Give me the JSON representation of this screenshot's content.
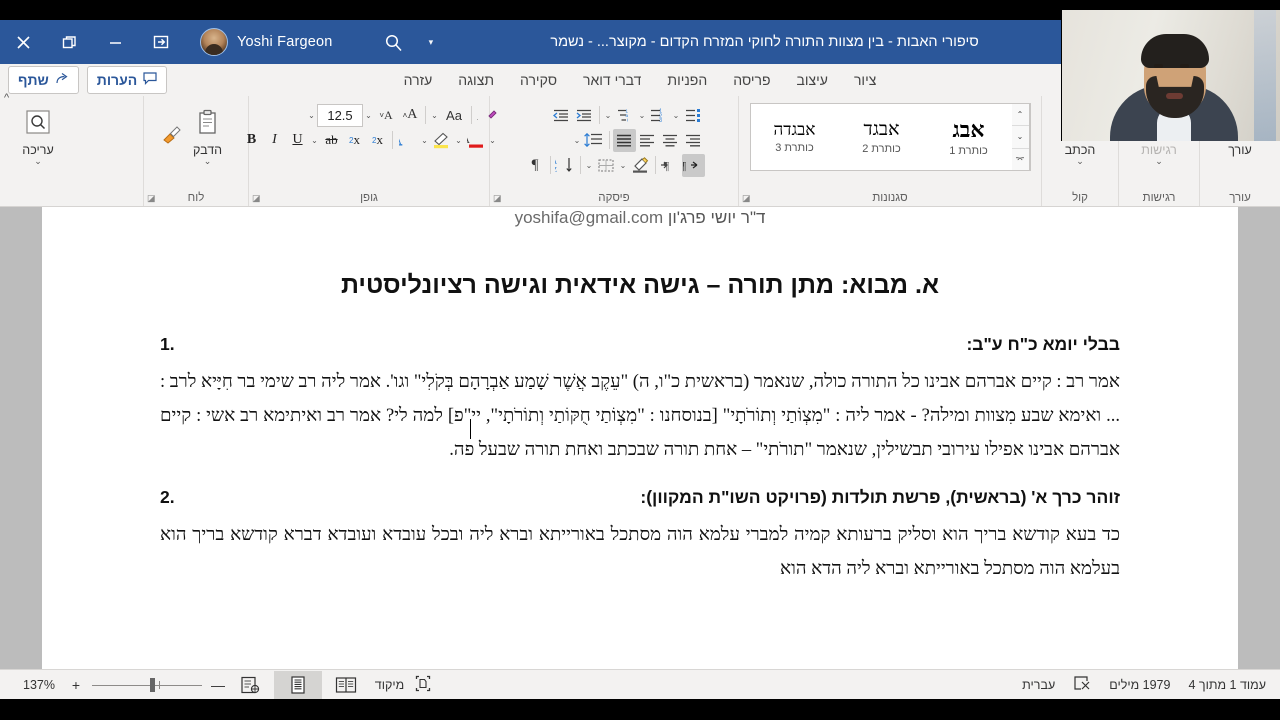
{
  "titlebar": {
    "close_label": "✕",
    "restore_label": "restore",
    "minimize_label": "—",
    "popout_label": "popout",
    "user_name": "Yoshi Fargeon",
    "search_icon": "search-icon",
    "caret": "▾",
    "document_title": "סיפורי האבות - בין מצוות התורה לחוקי המזרח הקדום - מקוצר... - נשמר",
    "autosave_caret": "▾",
    "undo_icon": "undo-icon",
    "redo_icon": "redo-icon",
    "more_caret": "▾"
  },
  "quick_pills": [
    {
      "label": "שתף",
      "icon": "share-icon"
    },
    {
      "label": "הערות",
      "icon": "comment-icon"
    }
  ],
  "tabs": [
    "ציור",
    "עיצוב",
    "פריסה",
    "הפניות",
    "דברי דואר",
    "סקירה",
    "תצוגה",
    "עזרה"
  ],
  "ribbon": {
    "groups": [
      {
        "name": "clipboard",
        "label": "לוח",
        "dialog": "◪",
        "buttons": [
          {
            "label": "הדבק",
            "icon": "paste-icon",
            "caret": "⌄"
          },
          {
            "label": "",
            "icon": "format-painter-icon",
            "caret": ""
          }
        ]
      },
      {
        "name": "font",
        "label": "גופן",
        "dialog": "◪",
        "font_size": "12.5",
        "row1": [
          {
            "icon": "clear-formatting-icon",
            "name": "clear-formatting"
          },
          {
            "icon": "change-case-icon",
            "name": "change-case",
            "label": "Aa"
          },
          {
            "icon": "decrease-font-icon",
            "name": "decrease-font",
            "label": "A˅"
          },
          {
            "icon": "increase-font-icon",
            "name": "increase-font",
            "label": "A˄"
          }
        ],
        "row2": [
          {
            "icon": "font-color-icon",
            "name": "font-color",
            "label": "A"
          },
          {
            "icon": "highlight-icon",
            "name": "text-highlight"
          },
          {
            "icon": "text-effects-icon",
            "name": "text-effects",
            "label": "A"
          },
          {
            "icon": "superscript-icon",
            "name": "superscript",
            "label": "x²"
          },
          {
            "icon": "subscript-icon",
            "name": "subscript",
            "label": "x₂"
          },
          {
            "icon": "strikethrough-icon",
            "name": "strikethrough",
            "label": "ab"
          },
          {
            "icon": "underline-icon",
            "name": "underline",
            "label": "U"
          },
          {
            "icon": "italic-icon",
            "name": "italic",
            "label": "I"
          },
          {
            "icon": "bold-icon",
            "name": "bold",
            "label": "B"
          }
        ]
      },
      {
        "name": "paragraph",
        "label": "פיסקה",
        "dialog": "◪",
        "row1": [
          {
            "name": "bullets",
            "icon": "bullet-list-icon"
          },
          {
            "name": "numbering",
            "icon": "numbered-list-icon"
          },
          {
            "name": "multilevel",
            "icon": "multilevel-list-icon"
          },
          {
            "name": "decrease-indent",
            "icon": "decrease-indent-icon"
          },
          {
            "name": "increase-indent",
            "icon": "increase-indent-icon"
          }
        ],
        "row2": [
          {
            "name": "align-right",
            "icon": "align-right-icon"
          },
          {
            "name": "align-center",
            "icon": "align-center-icon"
          },
          {
            "name": "align-left",
            "icon": "align-left-icon"
          },
          {
            "name": "justify",
            "icon": "justify-icon",
            "active": true
          },
          {
            "name": "line-spacing",
            "icon": "line-spacing-icon"
          }
        ],
        "row3": [
          {
            "name": "rtl-text-direction",
            "icon": "rtl-direction-icon",
            "label": "¶<",
            "active": true
          },
          {
            "name": "ltr-text-direction",
            "icon": "ltr-direction-icon",
            "label": ">¶"
          },
          {
            "name": "shading",
            "icon": "shading-icon"
          },
          {
            "name": "borders",
            "icon": "borders-icon"
          },
          {
            "name": "sort",
            "icon": "sort-az-icon"
          },
          {
            "name": "show-marks",
            "icon": "pilcrow-icon",
            "label": "¶"
          }
        ]
      },
      {
        "name": "styles",
        "label": "סגנונות",
        "dialog": "◪",
        "items": [
          {
            "sample": "אבג",
            "caption": "כותרת 1",
            "size": "22"
          },
          {
            "sample": "אבגד",
            "caption": "כותרת 2",
            "size": "19"
          },
          {
            "sample": "אבגדה",
            "caption": "כותרת 3",
            "size": "17"
          }
        ]
      },
      {
        "name": "voice",
        "label": "קול",
        "buttons": [
          {
            "label": "הכתב",
            "icon": "microphone-icon",
            "caret": "⌄"
          }
        ]
      },
      {
        "name": "sensitivity",
        "label": "רגישות",
        "buttons": [
          {
            "label": "רגישות",
            "icon": "sensitivity-label-icon",
            "caret": "⌄",
            "disabled": true
          }
        ]
      },
      {
        "name": "editor",
        "label": "עורך",
        "buttons": [
          {
            "label": "עורך",
            "icon": "editor-pen-icon",
            "caret": ""
          }
        ]
      }
    ],
    "find_group": {
      "label": "עריכה",
      "icon": "find-icon",
      "caret": "⌄"
    },
    "collapse_icon": "^"
  },
  "document": {
    "header_line": {
      "name_he": "ד\"ר יושי פרג'ון",
      "email": "yoshifa@gmail.com"
    },
    "title": "א. מבוא: מתן תורה – גישה אידאית וגישה רציונליסטית",
    "items": [
      {
        "number": "1.",
        "heading": "בבלי יומא כ\"ח ע\"ב:",
        "paragraphs": [
          "אמר רב : קיים אברהם אבינו כל התורה כולה, שנאמר (בראשית כ\"ו, ה) \"עֵקֶב אֲשֶׁר שָׁמַע אַבְרָהָם בְּקֹלִי\" וגו'. אמר ליה רב שימי בר חִיָּיא לרב : ... ואימא שבע מִצוות ומילה? - אמר ליה : \"מִצְוֹתַי וְתוֹרֹתָי\" [בנוסחנו : \"מִצְוֹתַי חֻקּוֹתַי וְתוֹרֹתָי\", יי\"פ] למה לי? אמר רב ואיתימא רב אשי : קיים אברהם אבינו אפילו עירובי תבשילין, שנאמר \"תורֹתי\" – אחת תורה שבכתב ואחת תורה שבעל פה."
        ]
      },
      {
        "number": "2.",
        "heading": "זוהר כרך א' (בראשית), פרשת תולדות (פרויקט השו\"ת המקוון):",
        "paragraphs": [
          "כד בעא קודשא בריך הוא וסליק ברעותא קמיה למברי עלמא הוה מסתכל באורייתא וברא ליה ובכל עובדא ועובדא דברא קודשא בריך הוא בעלמא הוה מסתכל באורייתא וברא ליה הדא הוא"
        ]
      }
    ]
  },
  "status": {
    "page_info": "עמוד 1 מתוך 4",
    "word_count": "1979 מילים",
    "proofing_icon": "proofing-error-icon",
    "language": "עברית",
    "focus_label": "מיקוד",
    "focus_icon": "focus-mode-icon",
    "view_read": "read-mode-icon",
    "view_print": "print-layout-icon",
    "view_web": "web-layout-icon",
    "zoom_out": "—",
    "zoom_in": "+",
    "zoom_level": "137%"
  },
  "colors": {
    "titlebar": "#2b579a",
    "ribbon": "#f3f2f1",
    "accent_blue": "#2b579a",
    "doc_background": "#bcbcbc",
    "spell_error": "#e05050"
  }
}
